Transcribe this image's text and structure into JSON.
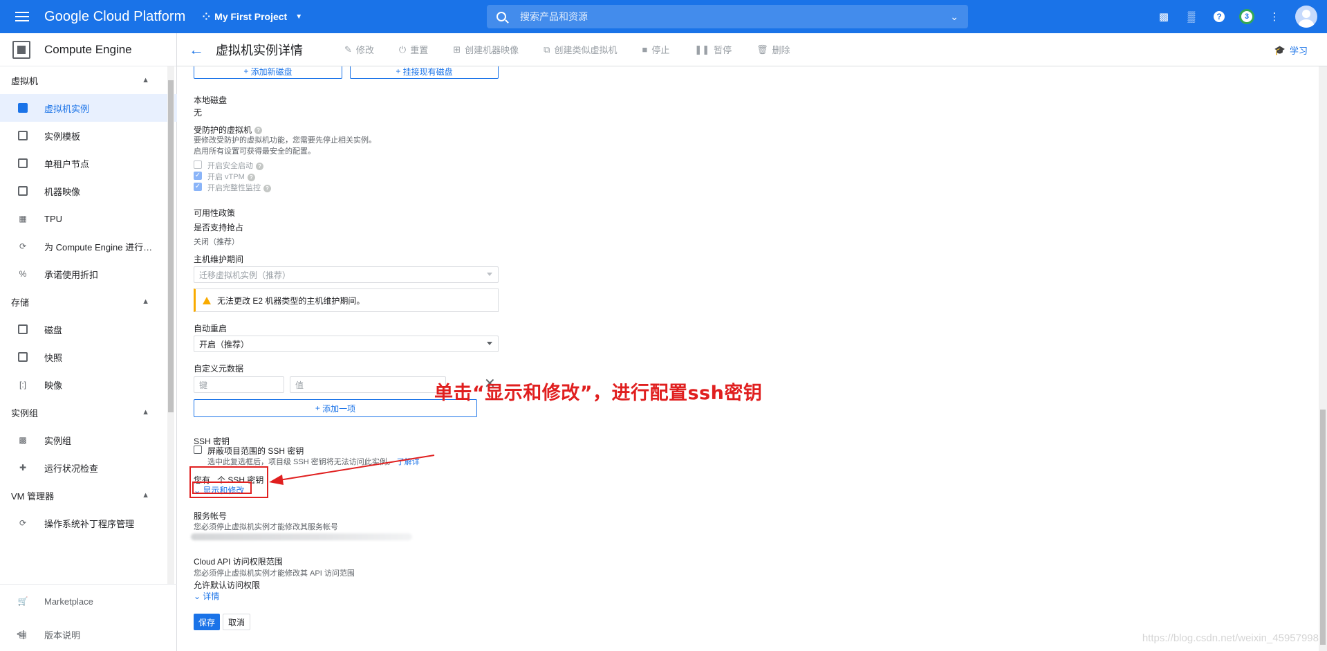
{
  "topbar": {
    "brand": "Google Cloud Platform",
    "project": "My First Project",
    "search_placeholder": "搜索产品和资源",
    "notification_count": "3"
  },
  "sidebar": {
    "product": "Compute Engine",
    "sections": [
      {
        "label": "虚拟机",
        "items": [
          "虚拟机实例",
          "实例模板",
          "单租户节点",
          "机器映像",
          "TPU",
          "为 Compute Engine 进行…",
          "承诺使用折扣"
        ]
      },
      {
        "label": "存储",
        "items": [
          "磁盘",
          "快照",
          "映像"
        ]
      },
      {
        "label": "实例组",
        "items": [
          "实例组",
          "运行状况检查"
        ]
      },
      {
        "label": "VM 管理器",
        "items": [
          "操作系统补丁程序管理"
        ]
      }
    ],
    "footer": [
      "Marketplace",
      "版本说明"
    ],
    "collapse_glyph": "<|"
  },
  "subheader": {
    "title": "虚拟机实例详情",
    "actions": [
      "修改",
      "重置",
      "创建机器映像",
      "创建类似虚拟机",
      "停止",
      "暂停",
      "删除"
    ],
    "learn": "学习"
  },
  "form": {
    "add_new_disk": "添加新磁盘",
    "attach_disk": "挂接现有磁盘",
    "local_disk_label": "本地磁盘",
    "local_disk_value": "无",
    "shielded_label": "受防护的虚拟机",
    "shielded_note1": "要修改受防护的虚拟机功能，您需要先停止相关实例。",
    "shielded_note2": "启用所有设置可获得最安全的配置。",
    "secure_boot": "开启安全启动",
    "vtpm": "开启 vTPM",
    "integrity": "开启完整性监控",
    "availability_label": "可用性政策",
    "preemptible_label": "是否支持抢占",
    "preemptible_value": "关闭（推荐）",
    "maintenance_label": "主机维护期间",
    "maintenance_value": "迁移虚拟机实例（推荐）",
    "maintenance_warning": "无法更改 E2 机器类型的主机维护期间。",
    "restart_label": "自动重启",
    "restart_value": "开启（推荐）",
    "metadata_label": "自定义元数据",
    "key_placeholder": "键",
    "value_placeholder": "值",
    "add_item": "添加一项",
    "ssh_label": "SSH 密钥",
    "block_ssh": "屏蔽项目范围的 SSH 密钥",
    "block_ssh_note": "选中此复选框后，项目级 SSH 密钥将无法访问此实例。",
    "learn_more": "了解详",
    "ssh_count_prefix": "您有",
    "ssh_count_suffix": "个 SSH 密钥",
    "show_edit": "显示和修改",
    "service_account_label": "服务帐号",
    "service_account_note": "您必须停止虚拟机实例才能修改其服务帐号",
    "api_scope_label": "Cloud API 访问权限范围",
    "api_scope_note": "您必须停止虚拟机实例才能修改其 API 访问范围",
    "api_scope_value": "允许默认访问权限",
    "details": "详情",
    "save": "保存",
    "cancel": "取消"
  },
  "annotation": "单击“显示和修改”，进行配置ssh密钥",
  "watermark": "https://blog.csdn.net/weixin_45957998",
  "colors": {
    "primary": "#1a73e8",
    "annotation": "#e01f1f",
    "warning": "#f9ab00"
  }
}
